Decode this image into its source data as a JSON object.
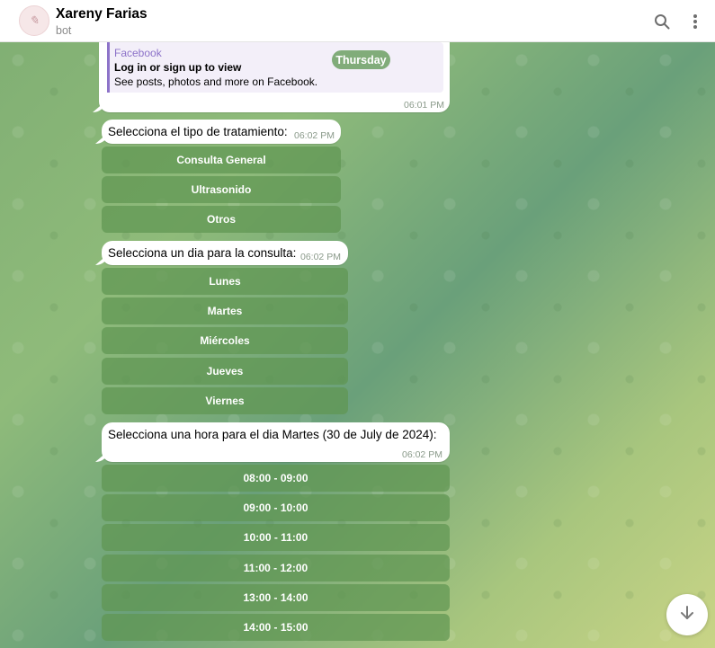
{
  "header": {
    "title": "Xareny Farias",
    "subtitle": "bot",
    "avatar_icon": "logo-avatar-icon",
    "actions": [
      "search-icon",
      "more-vert-icon"
    ]
  },
  "link_message": {
    "site": "Facebook",
    "title": "Log in or sign up to view",
    "description": "See posts, photos and more on Facebook.",
    "time": "06:01 PM"
  },
  "date_pill": "Thursday",
  "treatment": {
    "text": "Selecciona el tipo de tratamiento:",
    "time": "06:02 PM",
    "buttons": [
      "Consulta General",
      "Ultrasonido",
      "Otros"
    ]
  },
  "day": {
    "text": "Selecciona un dia para la consulta:",
    "time": "06:02 PM",
    "buttons": [
      "Lunes",
      "Martes",
      "Miércoles",
      "Jueves",
      "Viernes"
    ]
  },
  "hour": {
    "text": "Selecciona una hora para el dia Martes (30 de July de 2024):",
    "time": "06:02 PM",
    "buttons": [
      "08:00 - 09:00",
      "09:00 - 10:00",
      "10:00 - 11:00",
      "11:00 - 12:00",
      "13:00 - 14:00",
      "14:00 - 15:00"
    ]
  },
  "scroll_down_icon": "arrow-down-icon",
  "colors": {
    "header_bg": "#ffffff",
    "button_bg": "#6a9a5c",
    "link_accent": "#8d73c9",
    "date_pill_bg": "#6ca064"
  }
}
